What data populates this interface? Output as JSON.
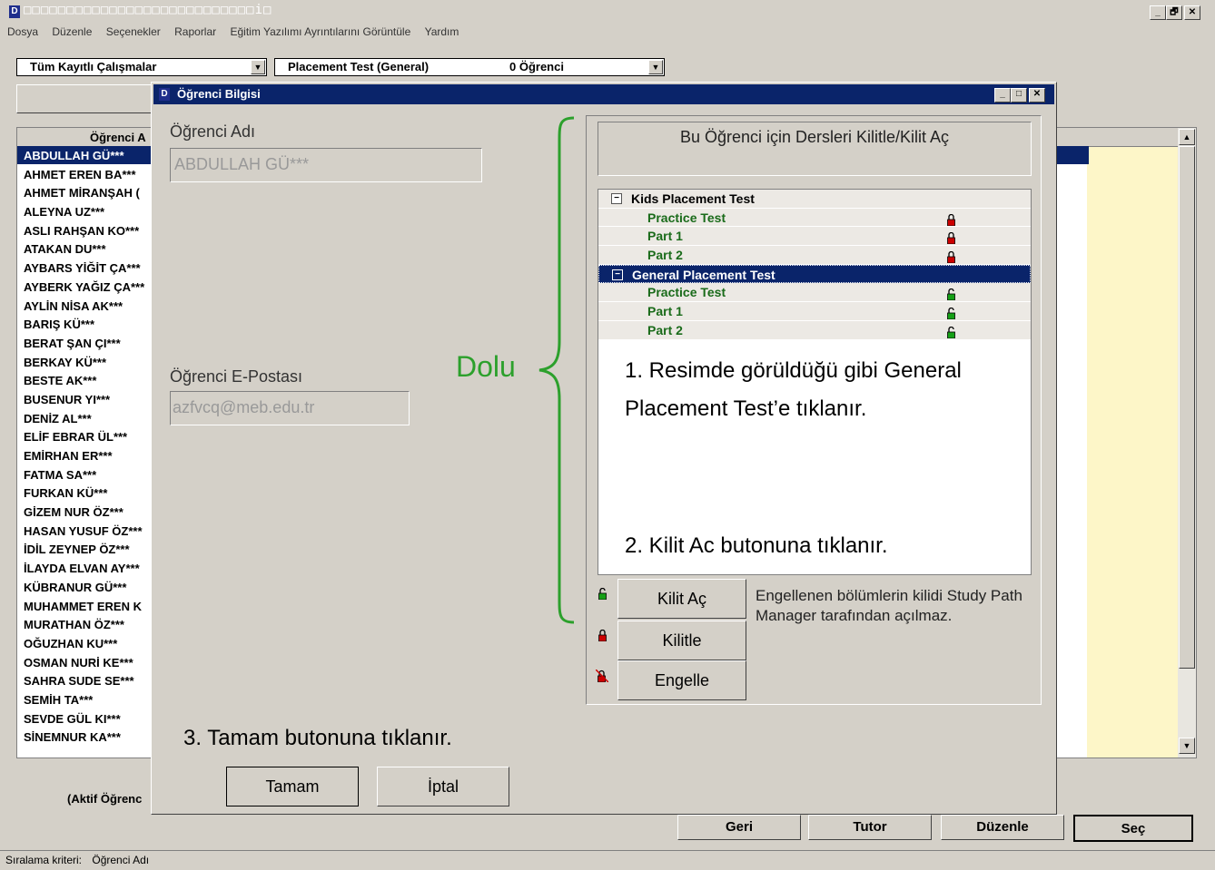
{
  "window": {
    "title_glyphs": "□□□□□□□□□□□□□□□□□□□□□□□□□□□i□",
    "controls": [
      "_",
      "🗗",
      "✕"
    ]
  },
  "menu": [
    "Dosya",
    "Düzenle",
    "Seçenekler",
    "Raporlar",
    "Eğitim Yazılımı Ayrıntılarını Görüntüle",
    "Yardım"
  ],
  "filter": {
    "studies": "Tüm Kayıtlı Çalışmalar",
    "test": "Placement Test (General)",
    "count": "0 Öğrenci"
  },
  "student_list": {
    "header": "Öğrenci A",
    "items": [
      "ABDULLAH GÜ***",
      "AHMET EREN BA***",
      "AHMET MİRANŞAH (",
      "ALEYNA UZ***",
      "ASLI RAHŞAN KO***",
      "ATAKAN DU***",
      "AYBARS YİĞİT ÇA***",
      "AYBERK YAĞIZ ÇA***",
      "AYLİN NİSA AK***",
      "BARIŞ KÜ***",
      "BERAT ŞAN ÇI***",
      "BERKAY KÜ***",
      "BESTE AK***",
      "BUSENUR YI***",
      "DENİZ AL***",
      "ELİF EBRAR ÜL***",
      "EMİRHAN ER***",
      "FATMA SA***",
      "FURKAN KÜ***",
      "GİZEM NUR ÖZ***",
      "HASAN YUSUF ÖZ***",
      "İDİL ZEYNEP ÖZ***",
      "İLAYDA ELVAN AY***",
      "KÜBRANUR GÜ***",
      "MUHAMMET EREN K",
      "MURATHAN ÖZ***",
      "OĞUZHAN KU***",
      "OSMAN NURİ KE***",
      "SAHRA SUDE SE***",
      "SEMİH TA***",
      "SEVDE GÜL KI***",
      "SİNEMNUR KA***"
    ],
    "footer": "(Aktif Öğrenc"
  },
  "bottom_buttons": {
    "back": "Geri",
    "tutor": "Tutor",
    "edit": "Düzenle",
    "select": "Seç"
  },
  "status": {
    "label": "Sıralama kriteri:",
    "value": "Öğrenci Adı"
  },
  "dialog": {
    "title": "Öğrenci Bilgisi",
    "name_label": "Öğrenci Adı",
    "name_value": "ABDULLAH GÜ***",
    "email_label": "Öğrenci E-Postası",
    "email_value": "azfvcq@meb.edu.tr",
    "lock_header": "Bu Öğrenci için Dersleri Kilitle/Kilit Aç",
    "tree": [
      {
        "label": "Kids Placement Test",
        "expander": "−",
        "children": [
          "Practice Test",
          "Part 1",
          "Part 2"
        ]
      },
      {
        "label": "General Placement Test",
        "expander": "−",
        "children": [
          "Practice Test",
          "Part 1",
          "Part 2"
        ]
      }
    ],
    "unlock_btn": "Kilit Aç",
    "lock_btn": "Kilitle",
    "block_btn": "Engelle",
    "note": "Engellenen bölümlerin kilidi Study Path Manager tarafından açılmaz.",
    "ok_btn": "Tamam",
    "cancel_btn": "İptal"
  },
  "annotations": {
    "dolu": "Dolu",
    "step1": "1. Resimde görüldüğü gibi General Placement Test’e tıklanır.",
    "step2": "2. Kilit Ac butonuna tıklanır.",
    "step3": "3. Tamam butonuna tıklanır."
  },
  "colors": {
    "selection": "#0a246a",
    "locked": "#cc0000",
    "unlocked": "#16a016",
    "tree_text": "#1a6b1a",
    "annotation_green": "#2ca02c",
    "yellow_panel": "#fdf6c8"
  }
}
